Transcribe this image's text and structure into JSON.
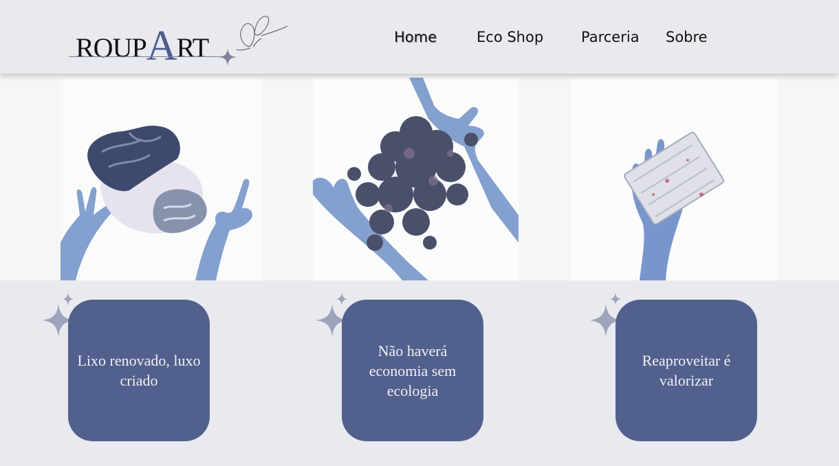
{
  "brand": {
    "logo_prefix": "ROUP",
    "logo_big": "A",
    "logo_suffix": "RT"
  },
  "nav": {
    "items": [
      {
        "label": "Home",
        "active": true
      },
      {
        "label": "Eco Shop",
        "active": false
      },
      {
        "label": "Parceria",
        "active": false
      },
      {
        "label": "Sobre",
        "active": false
      }
    ]
  },
  "gallery": {
    "images": [
      {
        "subject": "crumpled-fabric-with-hand-shadows"
      },
      {
        "subject": "shredded-fiber-with-hand-shadows"
      },
      {
        "subject": "recycled-fiber-block-with-hand-shadow"
      }
    ]
  },
  "cards": [
    {
      "text": "Lixo renovado, luxo criado"
    },
    {
      "text": "Não haverá economia sem ecologia"
    },
    {
      "text": "Reaproveitar é valorizar"
    }
  ],
  "colors": {
    "background": "#e9eaef",
    "card": "#52608d",
    "accent": "#4e5c8c",
    "shadow_blue": "#6f8fc6"
  },
  "icons": {
    "logo_sparkle": "four-point-star-icon",
    "butterfly": "butterfly-icon",
    "card_sparkle": "sparkle-icon"
  }
}
